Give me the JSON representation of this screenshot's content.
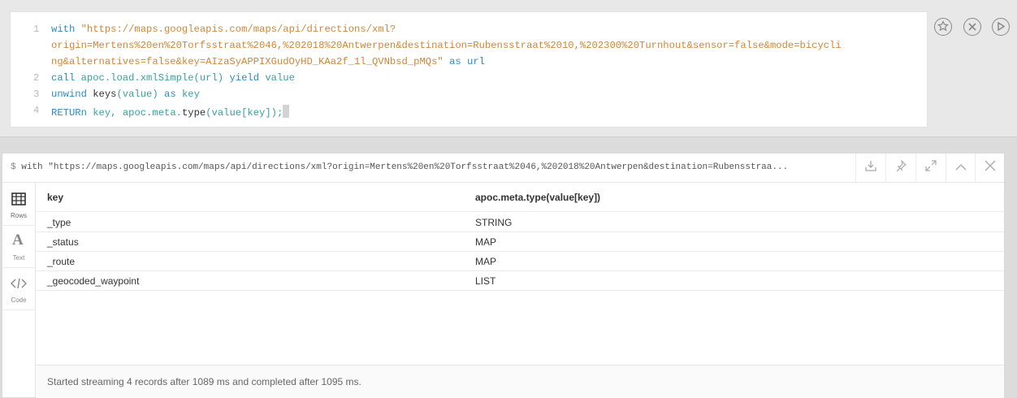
{
  "editor": {
    "lines": [
      {
        "num": "1",
        "text": "with \"https://maps.googleapis.com/maps/api/directions/xml?"
      },
      {
        "num": "",
        "text": "origin=Mertens%20en%20Torfsstraat%2046,%202018%20Antwerpen&destination=Rubensstraat%2010,%202300%20Turnhout&sensor=false&mode=bicycli"
      },
      {
        "num": "",
        "text": "ng&alternatives=false&key=AIzaSyAPPIXGudOyHD_KAa2f_1l_QVNbsd_pMQs\" as url"
      },
      {
        "num": "2",
        "text": "call apoc.load.xmlSimple(url) yield value"
      },
      {
        "num": "3",
        "text": "unwind keys(value) as key"
      },
      {
        "num": "4",
        "text": "RETURn key, apoc.meta.type(value[key]);"
      }
    ],
    "parts": {
      "l1_with": "with",
      "l1_str": "\"https://maps.googleapis.com/maps/api/directions/xml?",
      "l2_str": "origin=Mertens%20en%20Torfsstraat%2046,%202018%20Antwerpen&destination=Rubensstraat%2010,%202300%20Turnhout&sensor=false&mode=bicycli",
      "l3_str": "ng&alternatives=false&key=AIzaSyAPPIXGudOyHD_KAa2f_1l_QVNbsd_pMQs\"",
      "l3_as": "as",
      "l3_url": "url",
      "l4_call": "call",
      "l4_fn": "apoc.load.xmlSimple(url)",
      "l4_yield": "yield",
      "l4_value": "value",
      "l5_unwind": "unwind",
      "l5_keys": "keys",
      "l5_value": "(value)",
      "l5_as": "as",
      "l5_key": "key",
      "l6_return": "RETURn",
      "l6_key": "key,",
      "l6_fn": "apoc.meta.",
      "l6_type": "type",
      "l6_args": "(value[key]);"
    },
    "buttons": [
      "star-icon",
      "close-icon",
      "play-icon"
    ]
  },
  "result": {
    "query_prompt": "$",
    "query_text": "with \"https://maps.googleapis.com/maps/api/directions/xml?origin=Mertens%20en%20Torfsstraat%2046,%202018%20Antwerpen&destination=Rubensstraa...",
    "header_icons": [
      "download-icon",
      "pin-icon",
      "expand-icon",
      "collapse-icon",
      "close-icon"
    ],
    "side_tabs": [
      {
        "label": "Rows",
        "icon": "table-icon",
        "active": true
      },
      {
        "label": "Text",
        "icon": "text-icon",
        "active": false
      },
      {
        "label": "Code",
        "icon": "code-icon",
        "active": false
      }
    ],
    "columns": [
      "key",
      "apoc.meta.type(value[key])"
    ],
    "rows": [
      [
        "_type",
        "STRING"
      ],
      [
        "_status",
        "MAP"
      ],
      [
        "_route",
        "MAP"
      ],
      [
        "_geocoded_waypoint",
        "LIST"
      ]
    ],
    "footer": "Started streaming 4 records after 1089 ms and completed after 1095 ms."
  }
}
